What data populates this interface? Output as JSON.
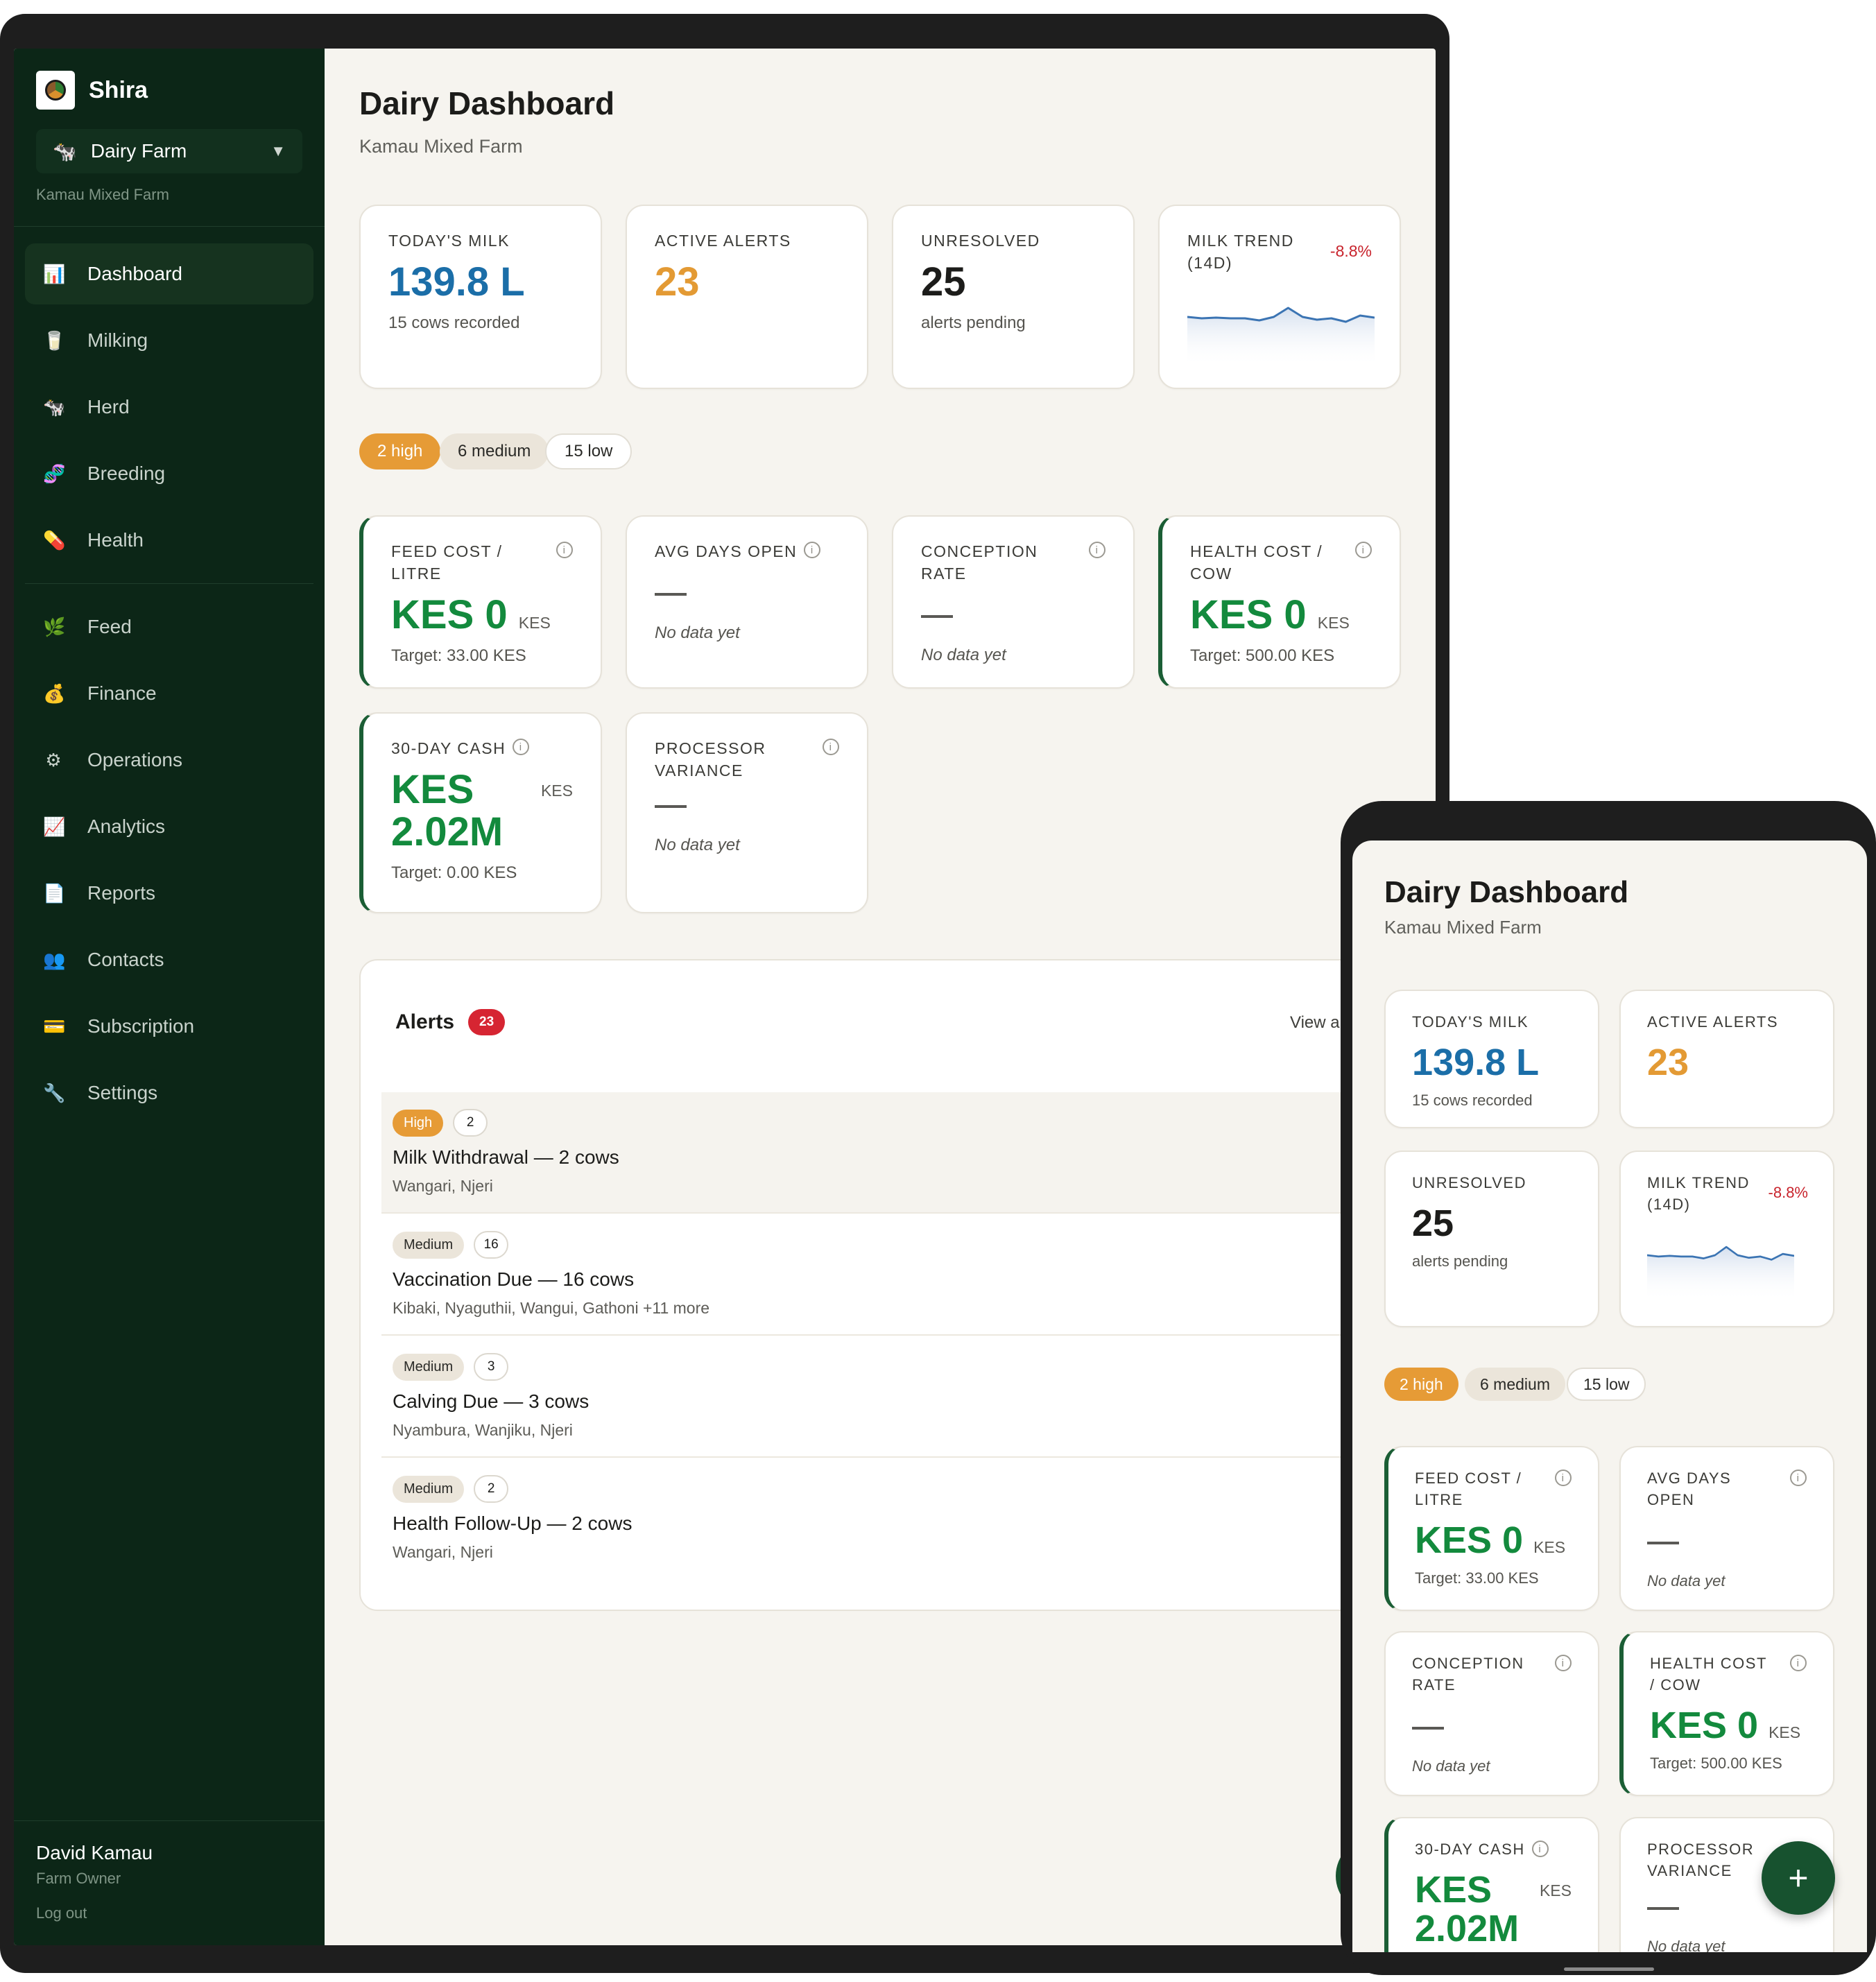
{
  "brand": {
    "name": "Shira"
  },
  "farm": {
    "selected": "Dairy Farm",
    "subtitle": "Kamau Mixed Farm"
  },
  "nav": {
    "primary": [
      {
        "label": "Dashboard",
        "icon": "bar-chart-icon"
      },
      {
        "label": "Milking",
        "icon": "milk-cup-icon"
      },
      {
        "label": "Herd",
        "icon": "cow-icon"
      },
      {
        "label": "Breeding",
        "icon": "dna-icon"
      },
      {
        "label": "Health",
        "icon": "pill-icon"
      }
    ],
    "secondary": [
      {
        "label": "Feed",
        "icon": "leaf-icon"
      },
      {
        "label": "Finance",
        "icon": "money-bag-icon"
      },
      {
        "label": "Operations",
        "icon": "gear-icon"
      },
      {
        "label": "Analytics",
        "icon": "line-chart-icon"
      },
      {
        "label": "Reports",
        "icon": "document-icon"
      },
      {
        "label": "Contacts",
        "icon": "people-icon"
      },
      {
        "label": "Subscription",
        "icon": "credit-card-icon"
      },
      {
        "label": "Settings",
        "icon": "wrench-icon"
      }
    ]
  },
  "user": {
    "name": "David Kamau",
    "role": "Farm Owner",
    "logout": "Log out"
  },
  "page": {
    "title": "Dairy Dashboard",
    "subtitle": "Kamau Mixed Farm"
  },
  "kpis": {
    "todays_milk": {
      "label": "TODAY'S MILK",
      "value": "139.8 L",
      "sub": "15 cows recorded"
    },
    "active_alerts": {
      "label": "ACTIVE ALERTS",
      "value": "23"
    },
    "unresolved": {
      "label": "UNRESOLVED",
      "value": "25",
      "sub": "alerts pending"
    },
    "milk_trend": {
      "label": "MILK TREND (14D)",
      "change": "-8.8%",
      "points": [
        0.62,
        0.6,
        0.61,
        0.6,
        0.6,
        0.57,
        0.62,
        0.75,
        0.62,
        0.58,
        0.6,
        0.55,
        0.64,
        0.61
      ]
    }
  },
  "severity_pills": {
    "high": "2 high",
    "medium": "6 medium",
    "low": "15 low"
  },
  "metrics": {
    "feed_cost": {
      "label": "FEED COST / LITRE",
      "value": "KES 0",
      "unit": "KES",
      "target": "Target: 33.00 KES"
    },
    "avg_days_open": {
      "label": "AVG DAYS OPEN",
      "empty": "No data yet"
    },
    "conception_rate": {
      "label": "CONCEPTION RATE",
      "empty": "No data yet"
    },
    "health_cost": {
      "label": "HEALTH COST / COW",
      "value": "KES 0",
      "unit": "KES",
      "target": "Target: 500.00 KES"
    },
    "cash_30d": {
      "label": "30-DAY CASH",
      "value_line1": "KES",
      "value_line2": "2.02M",
      "unit": "KES",
      "target": "Target: 0.00 KES"
    },
    "processor_variance": {
      "label": "PROCESSOR VARIANCE",
      "empty": "No data yet"
    }
  },
  "alerts": {
    "title": "Alerts",
    "count": "23",
    "view_all": "View a",
    "items": [
      {
        "severity": "High",
        "count": "2",
        "title": "Milk Withdrawal — 2 cows",
        "cows": "Wangari, Njeri"
      },
      {
        "severity": "Medium",
        "count": "16",
        "title": "Vaccination Due — 16 cows",
        "cows": "Kibaki, Nyaguthii, Wangui, Gathoni +11 more"
      },
      {
        "severity": "Medium",
        "count": "3",
        "title": "Calving Due — 3 cows",
        "cows": "Nyambura, Wanjiku, Njeri"
      },
      {
        "severity": "Medium",
        "count": "2",
        "title": "Health Follow-Up — 2 cows",
        "cows": "Wangari, Njeri"
      }
    ]
  },
  "colors": {
    "sidebar": "#0c2617",
    "accent_green": "#138a3d",
    "milk_blue": "#1b6ea8",
    "alert_orange": "#e39a34",
    "negative_red": "#c8232c"
  },
  "fab": {
    "label": "+"
  }
}
